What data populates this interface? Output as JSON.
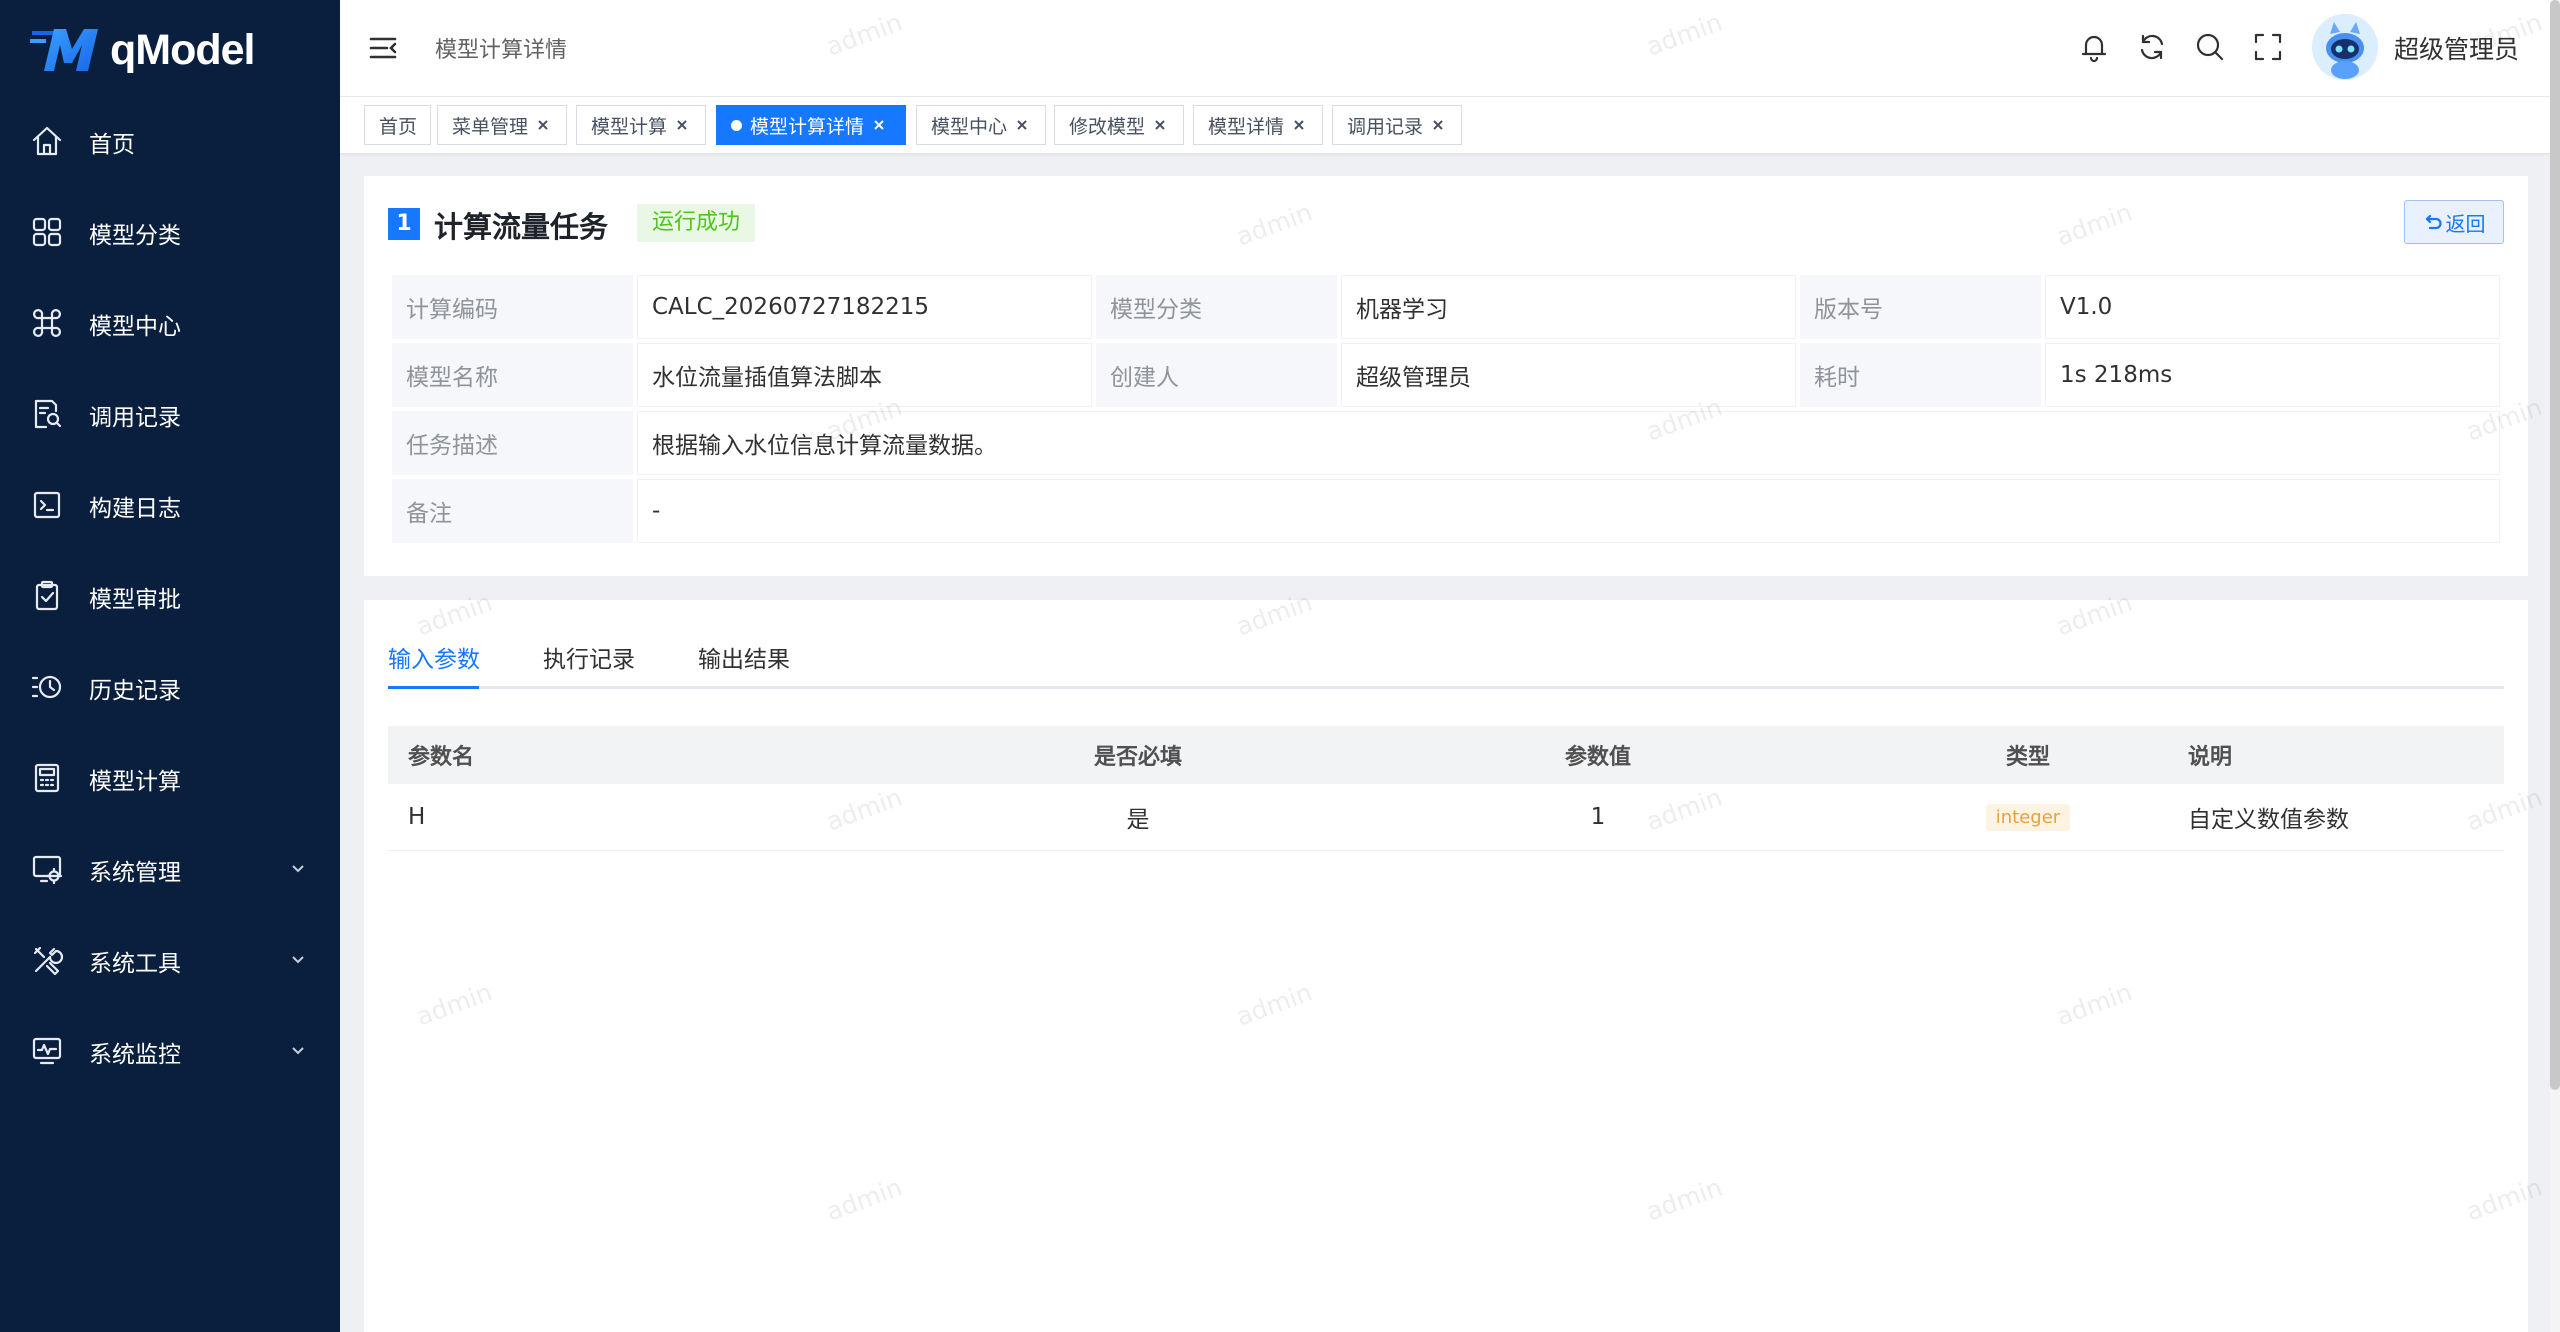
{
  "app": {
    "logo_text": "qModel"
  },
  "sidebar": {
    "items": [
      {
        "label": "首页",
        "icon": "home-icon"
      },
      {
        "label": "模型分类",
        "icon": "grid-icon"
      },
      {
        "label": "模型中心",
        "icon": "command-icon"
      },
      {
        "label": "调用记录",
        "icon": "document-search-icon"
      },
      {
        "label": "构建日志",
        "icon": "terminal-icon"
      },
      {
        "label": "模型审批",
        "icon": "clipboard-check-icon"
      },
      {
        "label": "历史记录",
        "icon": "history-icon"
      },
      {
        "label": "模型计算",
        "icon": "calculator-icon"
      },
      {
        "label": "系统管理",
        "icon": "system-settings-icon",
        "has_children": true
      },
      {
        "label": "系统工具",
        "icon": "tools-icon",
        "has_children": true
      },
      {
        "label": "系统监控",
        "icon": "monitor-icon",
        "has_children": true
      }
    ]
  },
  "header": {
    "breadcrumb": "模型计算详情",
    "username": "超级管理员",
    "icons": [
      "bell-icon",
      "refresh-icon",
      "search-icon",
      "fullscreen-icon"
    ]
  },
  "tags": [
    {
      "label": "首页",
      "closable": false,
      "active": false
    },
    {
      "label": "菜单管理",
      "closable": true,
      "active": false
    },
    {
      "label": "模型计算",
      "closable": true,
      "active": false
    },
    {
      "label": "模型计算详情",
      "closable": true,
      "active": true
    },
    {
      "label": "模型中心",
      "closable": true,
      "active": false
    },
    {
      "label": "修改模型",
      "closable": true,
      "active": false
    },
    {
      "label": "模型详情",
      "closable": true,
      "active": false
    },
    {
      "label": "调用记录",
      "closable": true,
      "active": false
    }
  ],
  "detail": {
    "number": "1",
    "title": "计算流量任务",
    "status": "运行成功",
    "back_label": "返回",
    "fields": {
      "calc_code_label": "计算编码",
      "calc_code": "CALC_20260727182215",
      "category_label": "模型分类",
      "category": "机器学习",
      "version_label": "版本号",
      "version": "V1.0",
      "model_name_label": "模型名称",
      "model_name": "水位流量插值算法脚本",
      "creator_label": "创建人",
      "creator": "超级管理员",
      "duration_label": "耗时",
      "duration": "1s 218ms",
      "desc_label": "任务描述",
      "desc": "根据输入水位信息计算流量数据。",
      "remark_label": "备注",
      "remark": "-"
    }
  },
  "tabs": [
    {
      "label": "输入参数",
      "active": true
    },
    {
      "label": "执行记录",
      "active": false
    },
    {
      "label": "输出结果",
      "active": false
    }
  ],
  "params_table": {
    "headers": [
      "参数名",
      "是否必填",
      "参数值",
      "类型",
      "说明"
    ],
    "rows": [
      {
        "name": "H",
        "required": "是",
        "value": "1",
        "type": "integer",
        "note": "自定义数值参数"
      }
    ]
  },
  "watermark": "admin",
  "colors": {
    "primary": "#1677ff",
    "sidebar_bg": "#0a1f3d",
    "success": "#52c41a",
    "warning": "#e6a23c"
  }
}
